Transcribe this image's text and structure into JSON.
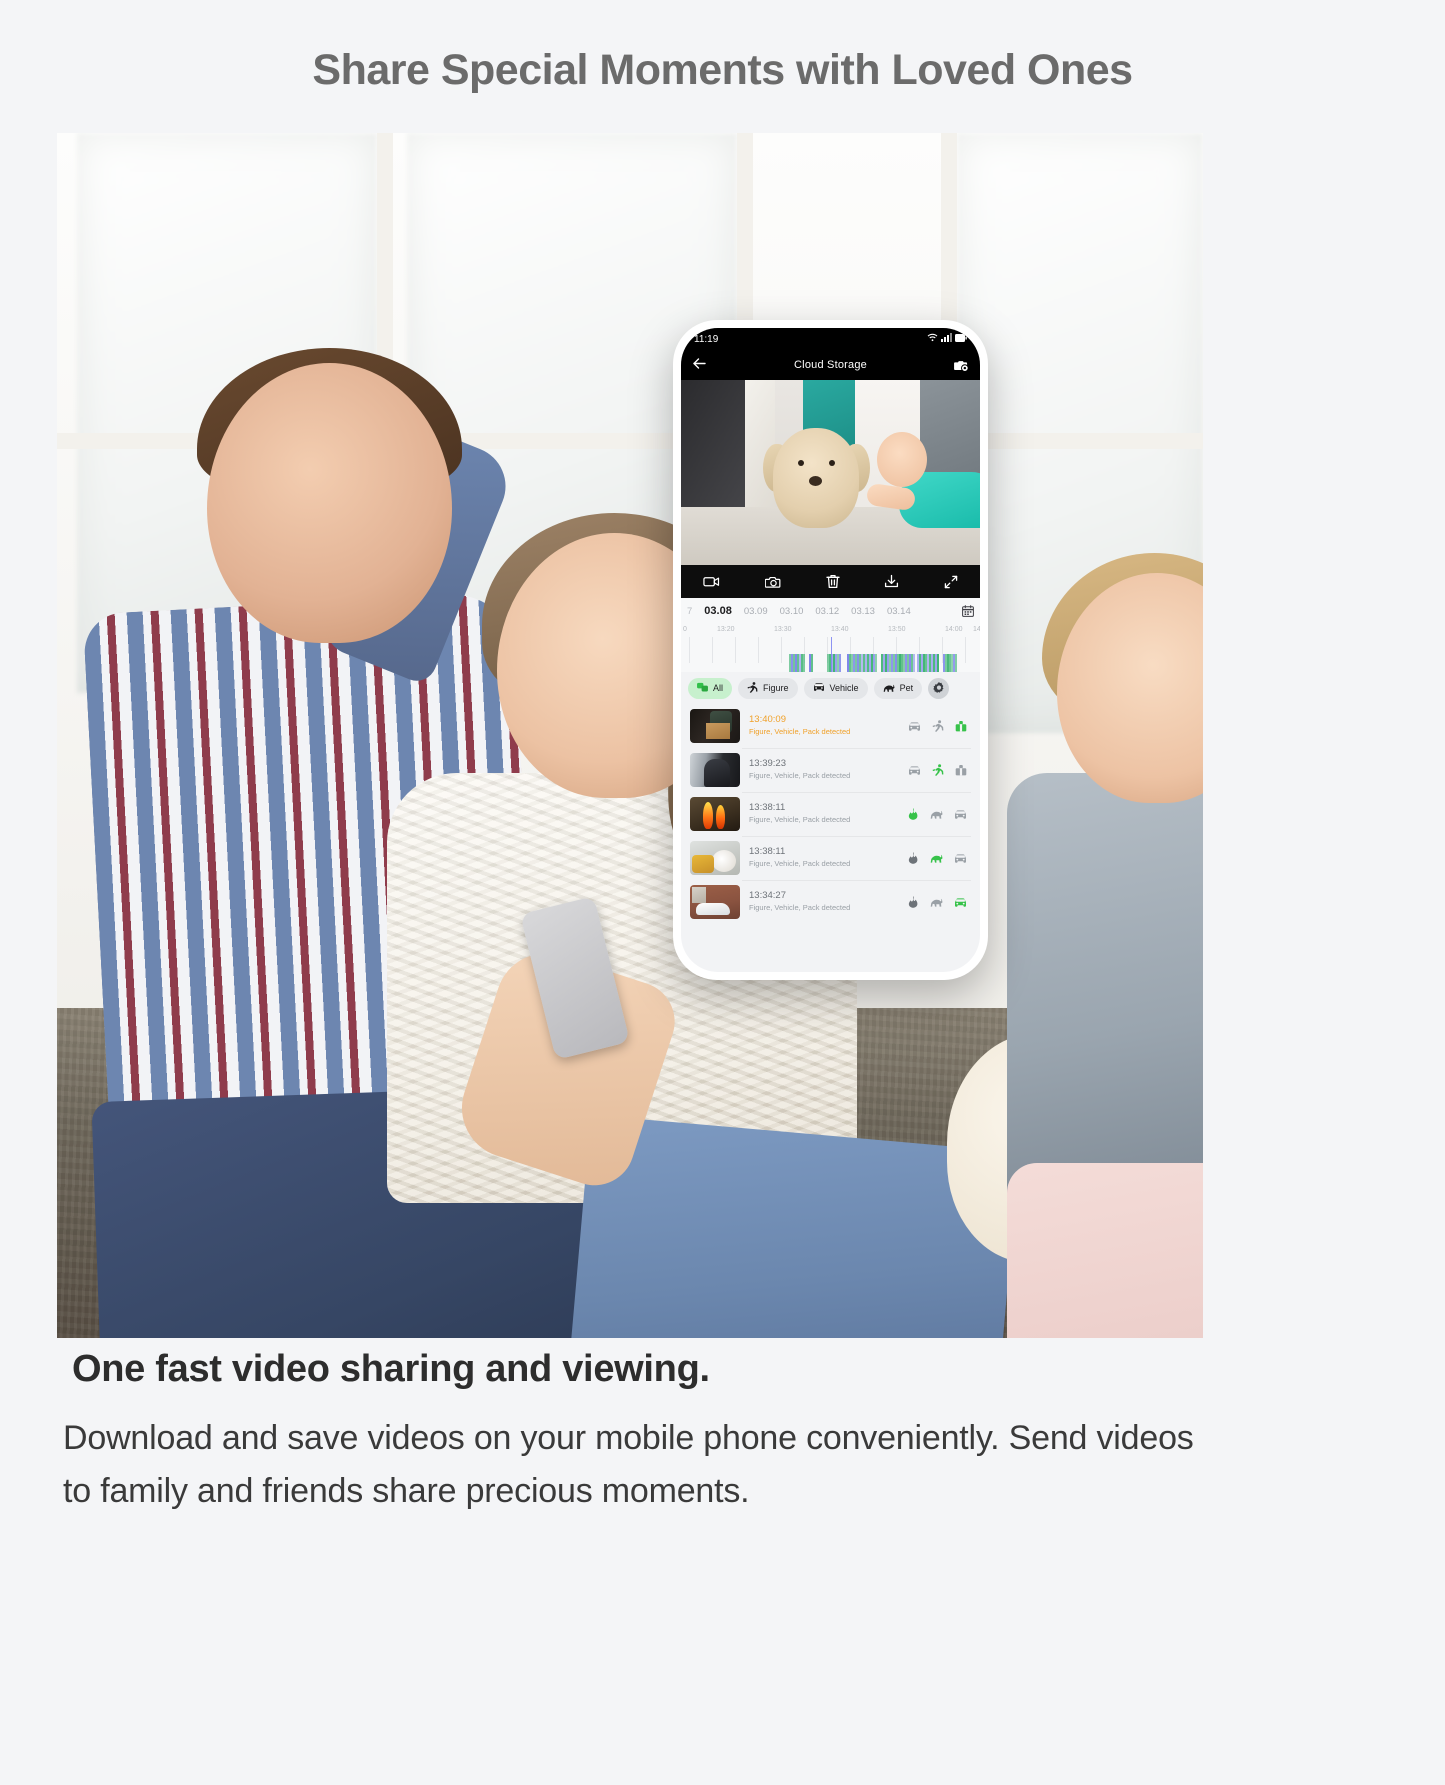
{
  "headline": "Share Special Moments with Loved Ones",
  "footer": {
    "title": "One fast video sharing and viewing.",
    "paragraph": "Download and save videos on your mobile phone conveniently. Send videos to family and friends share precious moments."
  },
  "phone": {
    "status": {
      "time": "11:19",
      "wifi_icon": "wifi-icon",
      "signal_icon": "signal-bars-icon",
      "battery_icon": "battery-icon"
    },
    "appbar": {
      "back_icon": "back-arrow-icon",
      "title": "Cloud Storage",
      "right_icon": "camera-settings-icon"
    },
    "media_toolbar": [
      {
        "name": "record-video-icon",
        "label": "Record"
      },
      {
        "name": "snapshot-camera-icon",
        "label": "Snapshot"
      },
      {
        "name": "delete-trash-icon",
        "label": "Delete"
      },
      {
        "name": "download-icon",
        "label": "Download"
      },
      {
        "name": "fullscreen-icon",
        "label": "Fullscreen"
      }
    ],
    "dates": {
      "cut_left": "7",
      "items": [
        {
          "label": "03.08",
          "active": true
        },
        {
          "label": "03.09",
          "active": false
        },
        {
          "label": "03.10",
          "active": false
        },
        {
          "label": "03.12",
          "active": false
        },
        {
          "label": "03.13",
          "active": false
        },
        {
          "label": "03.14",
          "active": false
        }
      ],
      "calendar_icon": "calendar-icon"
    },
    "timeline": {
      "cut_left": "0",
      "ticks": [
        "13:20",
        "13:30",
        "13:40",
        "13:50",
        "14:00"
      ],
      "cut_right": "14",
      "green": "#3cb371",
      "blue": "#7d85ea"
    },
    "filters": [
      {
        "label": "All",
        "icon": "all-events-icon",
        "active": true
      },
      {
        "label": "Figure",
        "icon": "person-running-icon",
        "active": false
      },
      {
        "label": "Vehicle",
        "icon": "car-icon",
        "active": false
      },
      {
        "label": "Pet",
        "icon": "pet-icon",
        "active": false
      }
    ],
    "filter_settings_icon": "settings-gear-icon",
    "events": [
      {
        "time": "13:40:09",
        "desc": "Figure, Vehicle, Pack detected",
        "highlight": true,
        "thumb": "package-delivery-thumb",
        "icons": [
          {
            "name": "car-icon",
            "active": false
          },
          {
            "name": "person-running-icon",
            "active": false
          },
          {
            "name": "package-icon",
            "active": true
          }
        ]
      },
      {
        "time": "13:39:23",
        "desc": "Figure, Vehicle, Pack detected",
        "highlight": false,
        "thumb": "intruder-thumb",
        "icons": [
          {
            "name": "car-icon",
            "active": false
          },
          {
            "name": "person-running-icon",
            "active": true
          },
          {
            "name": "package-icon",
            "active": false
          }
        ]
      },
      {
        "time": "13:38:11",
        "desc": "Figure, Vehicle, Pack detected",
        "highlight": false,
        "thumb": "fire-thumb",
        "icons": [
          {
            "name": "flame-icon",
            "active": true
          },
          {
            "name": "pet-icon",
            "active": false
          },
          {
            "name": "car-icon",
            "active": false
          }
        ]
      },
      {
        "time": "13:38:11",
        "desc": "Figure, Vehicle, Pack detected",
        "highlight": false,
        "thumb": "pet-mess-thumb",
        "icons": [
          {
            "name": "flame-icon",
            "active": false
          },
          {
            "name": "pet-icon",
            "active": true
          },
          {
            "name": "car-icon",
            "active": false
          }
        ]
      },
      {
        "time": "13:34:27",
        "desc": "Figure, Vehicle, Pack detected",
        "highlight": false,
        "thumb": "white-car-thumb",
        "icons": [
          {
            "name": "flame-icon",
            "active": false
          },
          {
            "name": "pet-icon",
            "active": false
          },
          {
            "name": "car-icon",
            "active": true
          }
        ]
      }
    ]
  },
  "colors": {
    "page_bg": "#f4f5f7",
    "headline": "#6b6b6b",
    "accent_green": "#37c24a",
    "highlight_orange": "#f0a12a",
    "chip_active_bg": "#c7f0cd"
  }
}
